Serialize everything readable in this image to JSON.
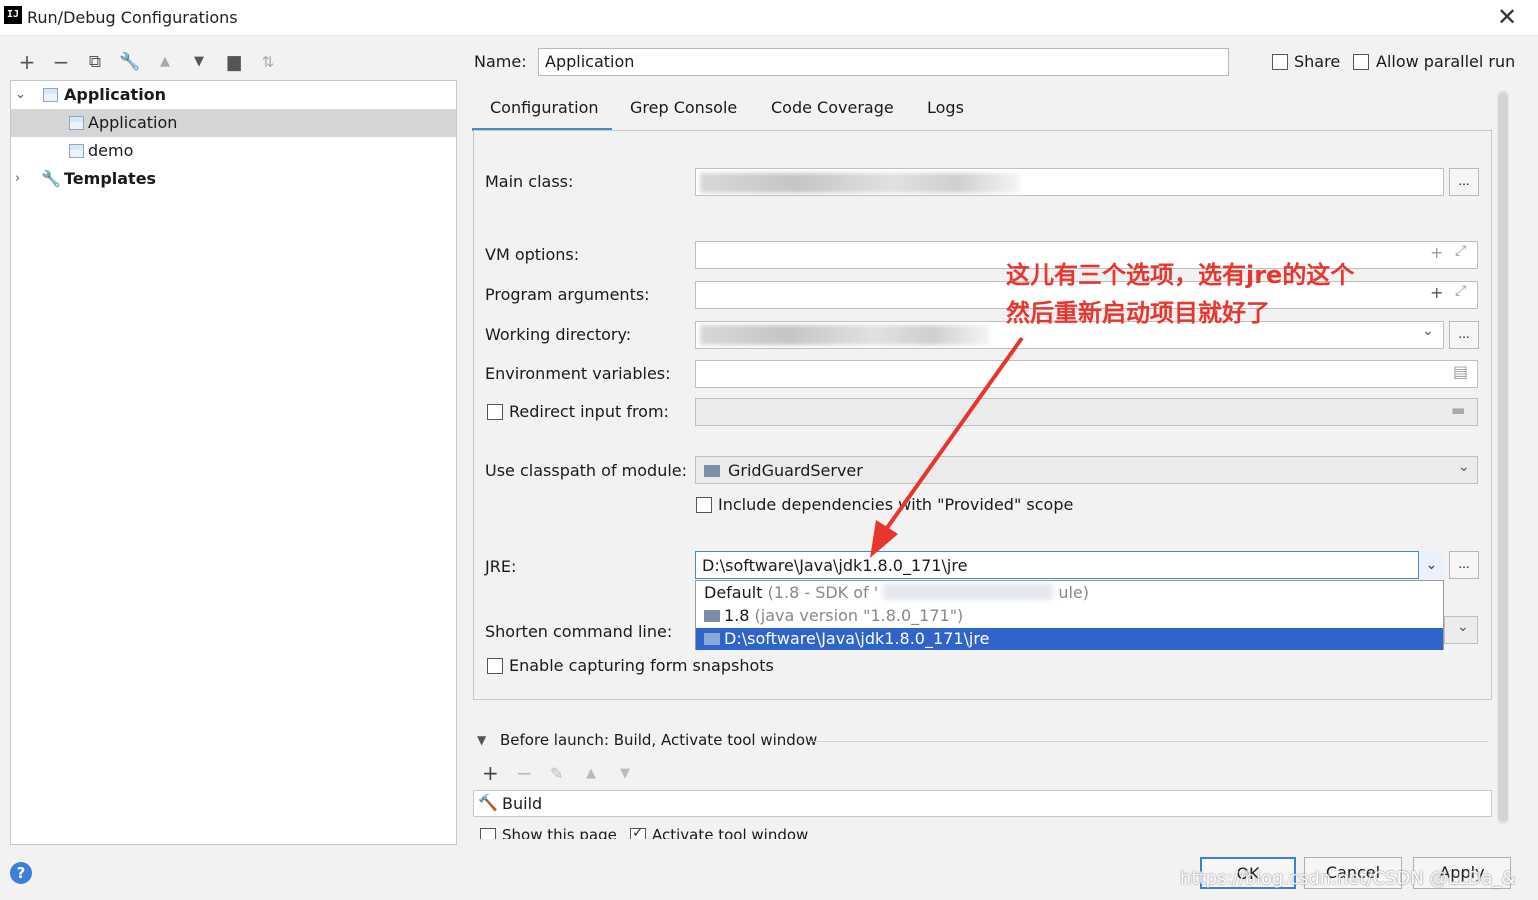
{
  "window": {
    "title": "Run/Debug Configurations",
    "close": "✕",
    "app_icon": "IJ"
  },
  "tree": {
    "items": [
      {
        "label": "Application",
        "type": "group",
        "expanded": true
      },
      {
        "label": "Application",
        "type": "config",
        "selected": true
      },
      {
        "label": "demo",
        "type": "config"
      },
      {
        "label": "Templates",
        "type": "group",
        "expanded": false
      }
    ]
  },
  "header": {
    "name_label": "Name:",
    "name_value": "Application",
    "share_label": "Share",
    "allow_parallel_label": "Allow parallel run"
  },
  "tabs": [
    "Configuration",
    "Grep Console",
    "Code Coverage",
    "Logs"
  ],
  "form": {
    "main_class_label": "Main class:",
    "vm_options_label": "VM options:",
    "program_args_label": "Program arguments:",
    "working_dir_label": "Working directory:",
    "env_vars_label": "Environment variables:",
    "redirect_input_label": "Redirect input from:",
    "classpath_label": "Use classpath of module:",
    "classpath_value": "GridGuardServer",
    "include_deps_label": "Include dependencies with \"Provided\" scope",
    "jre_label": "JRE:",
    "jre_value": "D:\\software\\Java\\jdk1.8.0_171\\jre",
    "shorten_label": "Shorten command line:",
    "enable_snapshots_label": "Enable capturing form snapshots",
    "dots": "..."
  },
  "jre_options": [
    {
      "main": "Default",
      "detail": "(1.8 - SDK of '",
      "tail": "ule)"
    },
    {
      "main": "1.8",
      "detail": "(java version \"1.8.0_171\")"
    },
    {
      "main": "D:\\software\\Java\\jdk1.8.0_171\\jre",
      "detail": "",
      "selected": true
    }
  ],
  "annotation": {
    "line1": "这儿有三个选项，选有jre的这个",
    "line2": "然后重新启动项目就好了",
    "color": "#e8362f"
  },
  "before_launch": {
    "header": "Before launch: Build, Activate tool window",
    "task": "Build",
    "show_page_label": "Show this page",
    "activate_label": "Activate tool window"
  },
  "buttons": {
    "ok": "OK",
    "cancel": "Cancel",
    "apply": "Apply",
    "help": "?"
  },
  "watermark": "https://blog.csdn.net/CSDN @LLDa_&"
}
